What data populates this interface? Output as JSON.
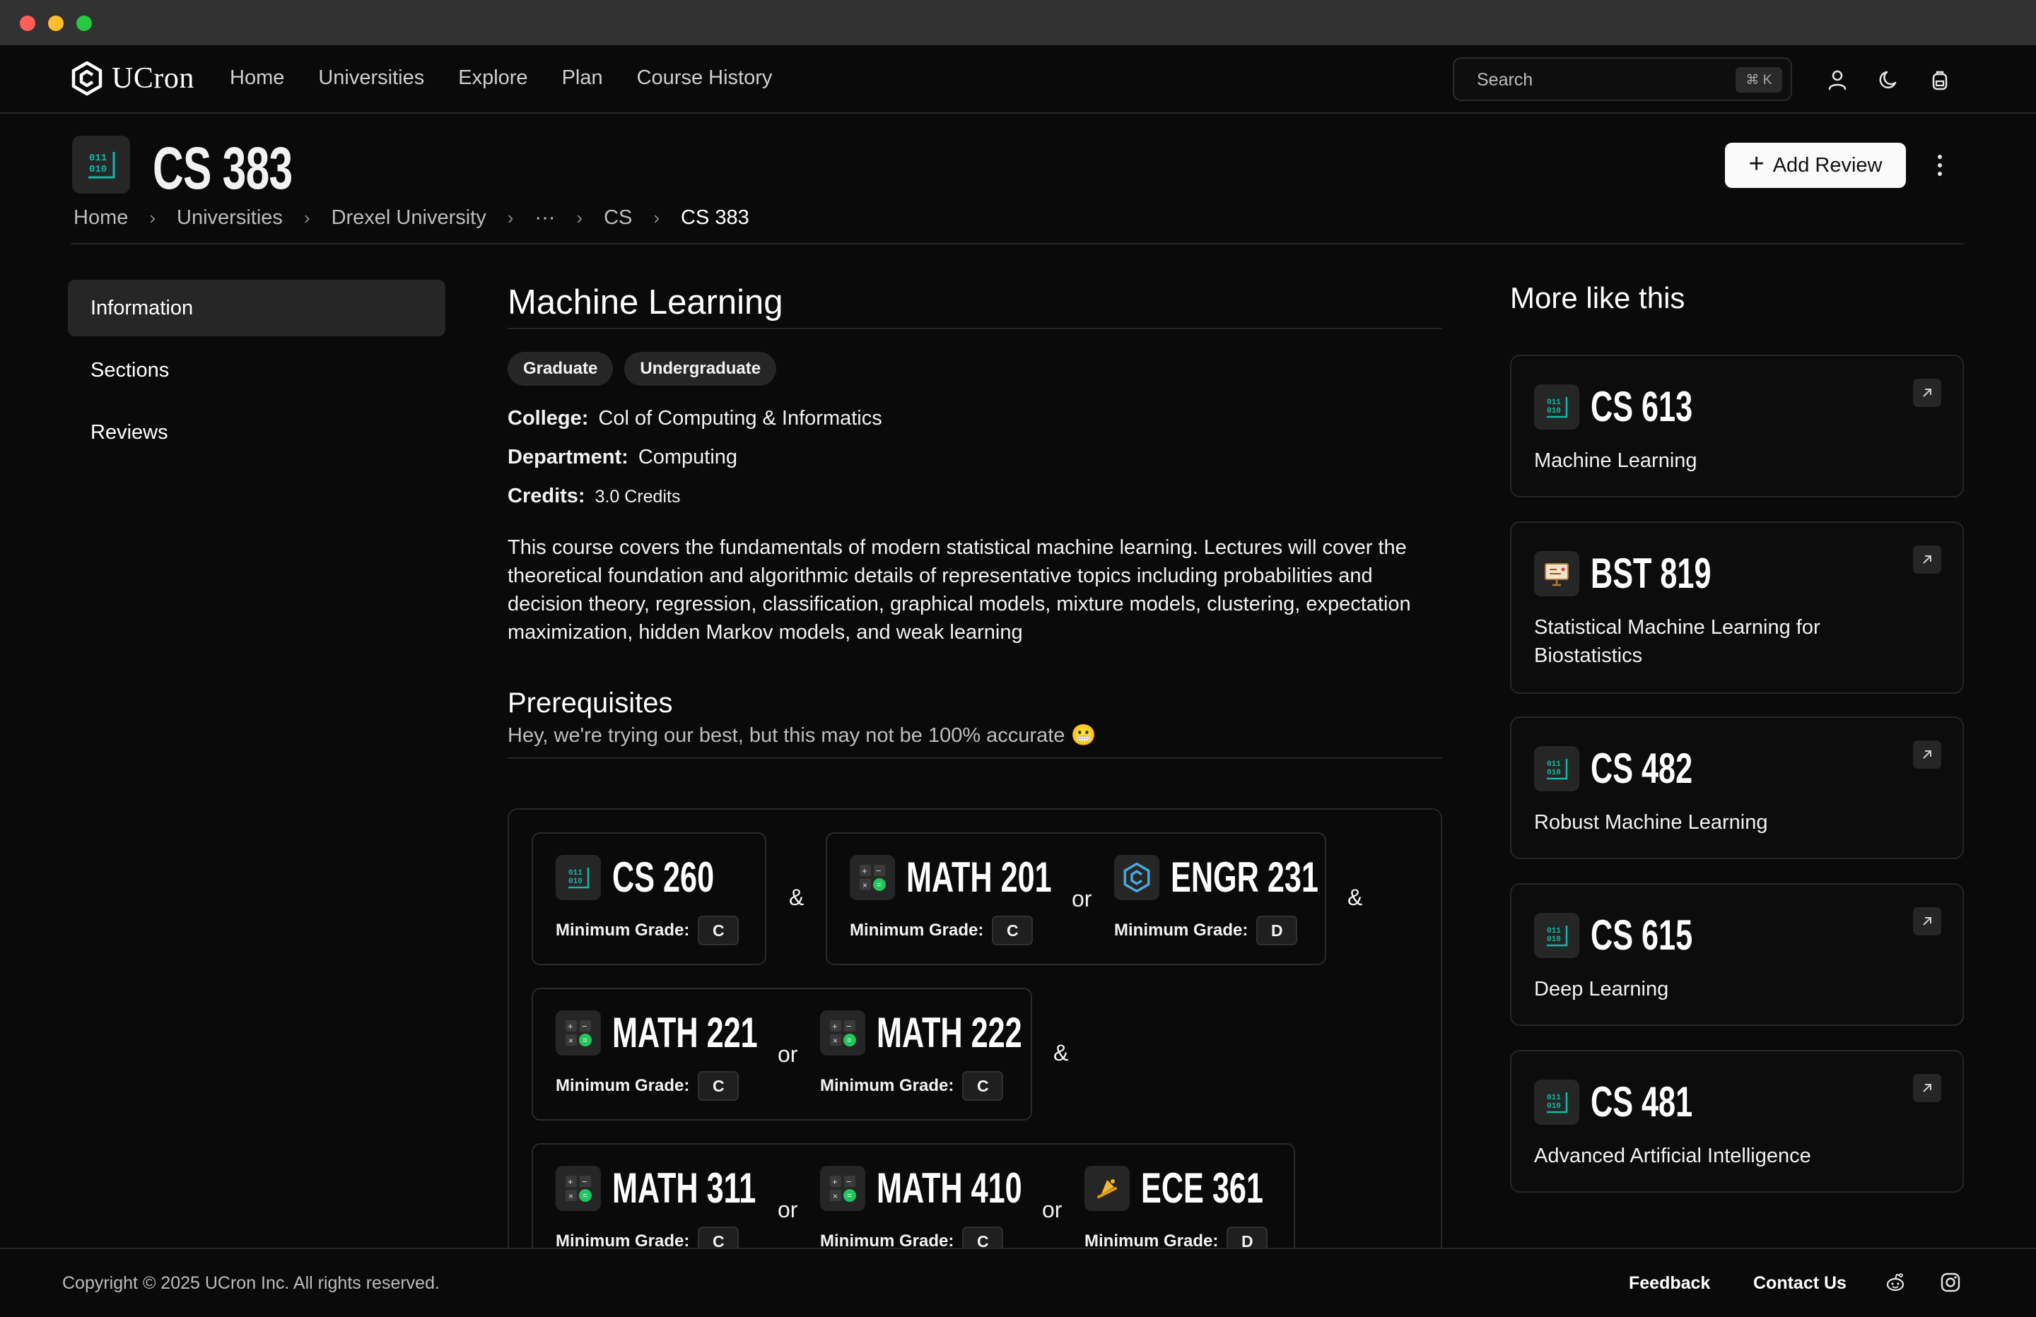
{
  "app": {
    "name": "UCron"
  },
  "nav": {
    "links": [
      "Home",
      "Universities",
      "Explore",
      "Plan",
      "Course History"
    ],
    "search_placeholder": "Search",
    "search_shortcut": "⌘ K",
    "icons": [
      "user-icon",
      "moon-icon",
      "backpack-icon"
    ]
  },
  "course": {
    "code": "CS 383",
    "title": "Machine Learning",
    "add_review_label": "Add Review",
    "breadcrumb": [
      "Home",
      "Universities",
      "Drexel University",
      "···",
      "CS",
      "CS 383"
    ],
    "badges": [
      "Graduate",
      "Undergraduate"
    ],
    "college_label": "College:",
    "college": "Col of Computing & Informatics",
    "department_label": "Department:",
    "department": "Computing",
    "credits_label": "Credits:",
    "credits": "3.0 Credits",
    "description": "This course covers the fundamentals of modern statistical machine learning. Lectures will cover the theoretical foundation and algorithmic details of representative topics including probabilities and decision theory, regression, classification, graphical models, mixture models, clustering, expectation maximization, hidden Markov models, and weak learning"
  },
  "sidebar": {
    "items": [
      "Information",
      "Sections",
      "Reviews"
    ],
    "active": "Information"
  },
  "prerequisites": {
    "heading": "Prerequisites",
    "subtitle": "Hey, we're trying our best, but this may not be 100% accurate 😬",
    "grade_label": "Minimum Grade:",
    "and_label": "&",
    "or_label": "or",
    "groups": [
      {
        "courses": [
          {
            "code": "CS 260",
            "grade": "C",
            "icon": "binary-icon"
          }
        ]
      },
      {
        "courses": [
          {
            "code": "MATH 201",
            "grade": "C",
            "icon": "calculator-icon"
          },
          {
            "code": "ENGR 231",
            "grade": "D",
            "icon": "hexagon-logo-icon"
          }
        ]
      },
      {
        "courses": [
          {
            "code": "MATH 221",
            "grade": "C",
            "icon": "calculator-icon"
          },
          {
            "code": "MATH 222",
            "grade": "C",
            "icon": "calculator-icon"
          }
        ]
      },
      {
        "courses": [
          {
            "code": "MATH 311",
            "grade": "C",
            "icon": "calculator-icon"
          },
          {
            "code": "MATH 410",
            "grade": "C",
            "icon": "calculator-icon"
          },
          {
            "code": "ECE 361",
            "grade": "D",
            "icon": "bell-icon"
          }
        ]
      }
    ]
  },
  "more_like_this": {
    "heading": "More like this",
    "cards": [
      {
        "code": "CS 613",
        "name": "Machine Learning",
        "icon": "binary-icon"
      },
      {
        "code": "BST 819",
        "name": "Statistical Machine Learning for Biostatistics",
        "icon": "presentation-icon"
      },
      {
        "code": "CS 482",
        "name": "Robust Machine Learning",
        "icon": "binary-icon"
      },
      {
        "code": "CS 615",
        "name": "Deep Learning",
        "icon": "binary-icon"
      },
      {
        "code": "CS 481",
        "name": "Advanced Artificial Intelligence",
        "icon": "binary-icon"
      }
    ]
  },
  "footer": {
    "copyright": "Copyright © 2025 UCron Inc. All rights reserved.",
    "links": [
      "Feedback",
      "Contact Us"
    ],
    "icons": [
      "reddit-icon",
      "instagram-icon"
    ]
  },
  "colors": {
    "background": "#0a0a0a",
    "surface": "#262626",
    "accent_teal": "#14b8a6",
    "accent_green": "#22c55e"
  }
}
